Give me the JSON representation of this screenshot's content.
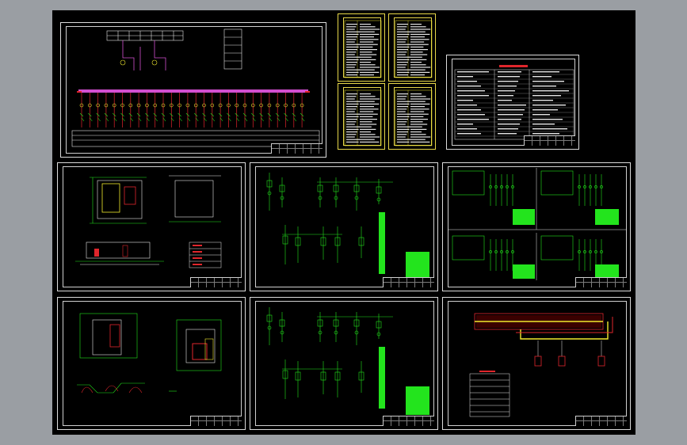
{
  "viewer": {
    "background_color": "#9a9ea3",
    "canvas_color": "#000000",
    "frame_color": "#dcdcdc",
    "schedule_frame_color": "#e8d84a"
  },
  "colors": {
    "wiring_green": "#23e41d",
    "wiring_red": "#e0262c",
    "wiring_yellow": "#f2ea2e",
    "wiring_magenta": "#d24fd0",
    "wiring_cyan": "#38d8e0",
    "text_white": "#e6e6e6"
  },
  "sheets": [
    {
      "id": "primary-wiring",
      "kind": "single-line-diagram"
    },
    {
      "id": "schedule-1",
      "kind": "equipment-schedule"
    },
    {
      "id": "schedule-2",
      "kind": "equipment-schedule"
    },
    {
      "id": "schedule-3",
      "kind": "equipment-schedule"
    },
    {
      "id": "schedule-4",
      "kind": "equipment-schedule"
    },
    {
      "id": "design-notes",
      "kind": "notes-table"
    },
    {
      "id": "substation-layout-1",
      "kind": "floor-plan"
    },
    {
      "id": "secondary-1",
      "kind": "control-schematic"
    },
    {
      "id": "secondary-2",
      "kind": "control-schematic"
    },
    {
      "id": "substation-layout-2",
      "kind": "floor-plan"
    },
    {
      "id": "secondary-3",
      "kind": "control-schematic"
    },
    {
      "id": "grounding",
      "kind": "grounding-plan"
    }
  ]
}
